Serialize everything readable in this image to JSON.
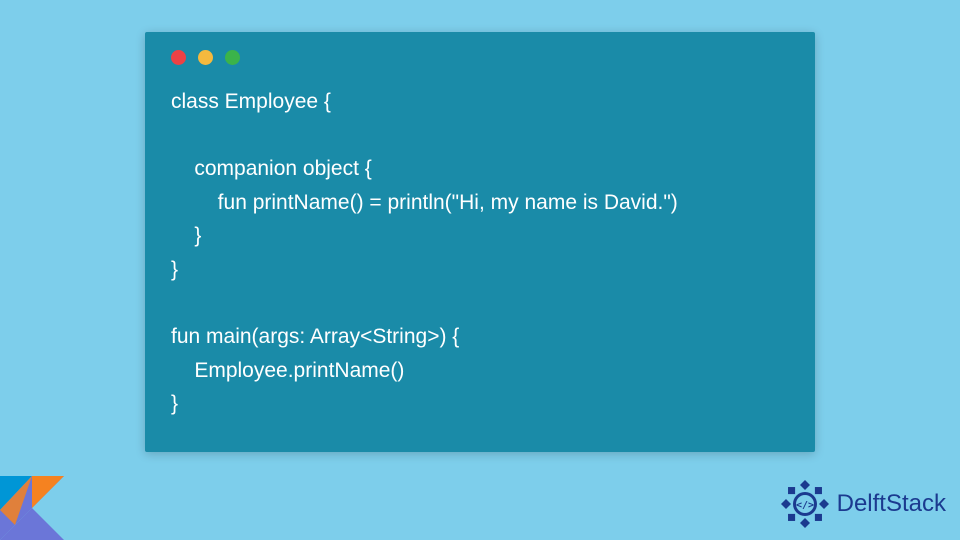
{
  "code": {
    "lines": [
      "class Employee {",
      "",
      "    companion object {",
      "        fun printName() = println(\"Hi, my name is David.\")",
      "    }",
      "}",
      "",
      "fun main(args: Array<String>) {",
      "    Employee.printName()",
      "}"
    ]
  },
  "traffic_lights": {
    "red": "#ed4245",
    "yellow": "#f5b93e",
    "green": "#3bb34a"
  },
  "brand": {
    "name": "DelftStack"
  },
  "icons": {
    "kotlin": "kotlin-logo",
    "delft": "delft-emblem"
  },
  "colors": {
    "page_bg": "#7dceeb",
    "window_bg": "#1a8ba8",
    "code_text": "#ffffff",
    "brand_text": "#1b3a8f"
  }
}
